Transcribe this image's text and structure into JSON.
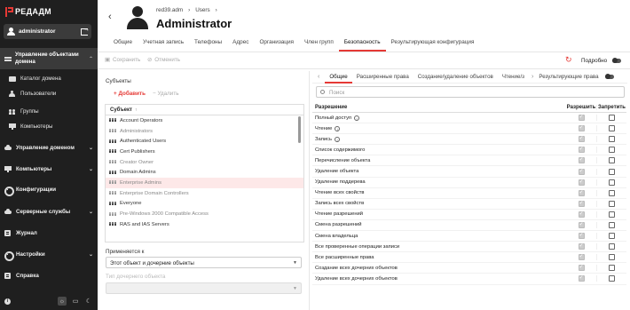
{
  "app": {
    "logo_text": "РЕДАДМ",
    "user": "administrator"
  },
  "sidebar": {
    "main_section": "Управление объектами домена",
    "sub_items": [
      {
        "label": "Каталог домена",
        "icon": "folder-icon"
      },
      {
        "label": "Пользователи",
        "icon": "user-icon"
      },
      {
        "label": "Группы",
        "icon": "group-icon"
      },
      {
        "label": "Компьютеры",
        "icon": "computer-icon"
      }
    ],
    "items": [
      {
        "label": "Управление доменом",
        "icon": "domain-icon",
        "expand": "⌄"
      },
      {
        "label": "Компьютеры",
        "icon": "computer-icon",
        "expand": "⌄"
      },
      {
        "label": "Конфигурации",
        "icon": "gear-icon",
        "expand": ""
      },
      {
        "label": "Серверные службы",
        "icon": "services-icon",
        "expand": "⌄"
      },
      {
        "label": "Журнал",
        "icon": "journal-icon",
        "expand": ""
      },
      {
        "label": "Настройки",
        "icon": "settings-icon",
        "expand": "⌄"
      },
      {
        "label": "Справка",
        "icon": "help-icon",
        "expand": ""
      }
    ]
  },
  "header": {
    "breadcrumb": [
      "red39.adm",
      "›",
      "Users",
      "›"
    ],
    "title": "Administrator",
    "tabs": [
      "Общие",
      "Учетная запись",
      "Телефоны",
      "Адрес",
      "Организация",
      "Член групп",
      "Безопасность",
      "Результирующая конфигурация"
    ],
    "active_tab": 6
  },
  "toolbar": {
    "save": "Сохранить",
    "cancel": "Отменить",
    "detail": "Подробно"
  },
  "subjects": {
    "label": "Субъекты",
    "add": "Добавить",
    "remove": "Удалить",
    "column": "Субъект",
    "rows": [
      {
        "name": "Account Operators",
        "dim": false
      },
      {
        "name": "Administrators",
        "dim": true
      },
      {
        "name": "Authenticated Users",
        "dim": false
      },
      {
        "name": "Cert Publishers",
        "dim": false
      },
      {
        "name": "Creator Owner",
        "dim": true
      },
      {
        "name": "Domain Admins",
        "dim": false
      },
      {
        "name": "Enterprise Admins",
        "dim": true,
        "selected": true
      },
      {
        "name": "Enterprise Domain Controllers",
        "dim": true
      },
      {
        "name": "Everyone",
        "dim": false
      },
      {
        "name": "Pre-Windows 2000 Compatible Access",
        "dim": true
      },
      {
        "name": "RAS and IAS Servers",
        "dim": false
      }
    ]
  },
  "applies": {
    "label": "Применяется к",
    "value": "Этот объект и дочерние объекты",
    "child_label": "Тип дочернего объекта"
  },
  "rights": {
    "tabs": [
      "Общие",
      "Расширенные права",
      "Создание/удаление объектов",
      "Чтение/з"
    ],
    "result_tab": "Результирующие права",
    "search_placeholder": "Поиск",
    "columns": [
      "Разрешение",
      "Разрешить",
      "Запретить"
    ],
    "rows": [
      {
        "name": "Полный доступ",
        "info": true,
        "allow": true,
        "deny": false
      },
      {
        "name": "Чтение",
        "info": true,
        "allow": true,
        "deny": false
      },
      {
        "name": "Запись",
        "info": true,
        "allow": true,
        "deny": false
      },
      {
        "name": "Список содержимого",
        "info": false,
        "allow": true,
        "deny": false
      },
      {
        "name": "Перечисление объекта",
        "info": false,
        "allow": true,
        "deny": false
      },
      {
        "name": "Удаление объекта",
        "info": false,
        "allow": true,
        "deny": false
      },
      {
        "name": "Удаление поддерева",
        "info": false,
        "allow": true,
        "deny": false
      },
      {
        "name": "Чтение всех свойств",
        "info": false,
        "allow": true,
        "deny": false
      },
      {
        "name": "Запись всех свойств",
        "info": false,
        "allow": true,
        "deny": false
      },
      {
        "name": "Чтение разрешений",
        "info": false,
        "allow": true,
        "deny": false
      },
      {
        "name": "Смена разрешений",
        "info": false,
        "allow": true,
        "deny": false
      },
      {
        "name": "Смена владельца",
        "info": false,
        "allow": true,
        "deny": false
      },
      {
        "name": "Все проверенные операции записи",
        "info": false,
        "allow": true,
        "deny": false
      },
      {
        "name": "Все расширенные права",
        "info": false,
        "allow": true,
        "deny": false
      },
      {
        "name": "Создание всех дочерних объектов",
        "info": false,
        "allow": true,
        "deny": false
      },
      {
        "name": "Удаление всех дочерних объектов",
        "info": false,
        "allow": true,
        "deny": false
      }
    ]
  },
  "colors": {
    "accent": "#e53935",
    "sidebar": "#1f1f1f"
  }
}
